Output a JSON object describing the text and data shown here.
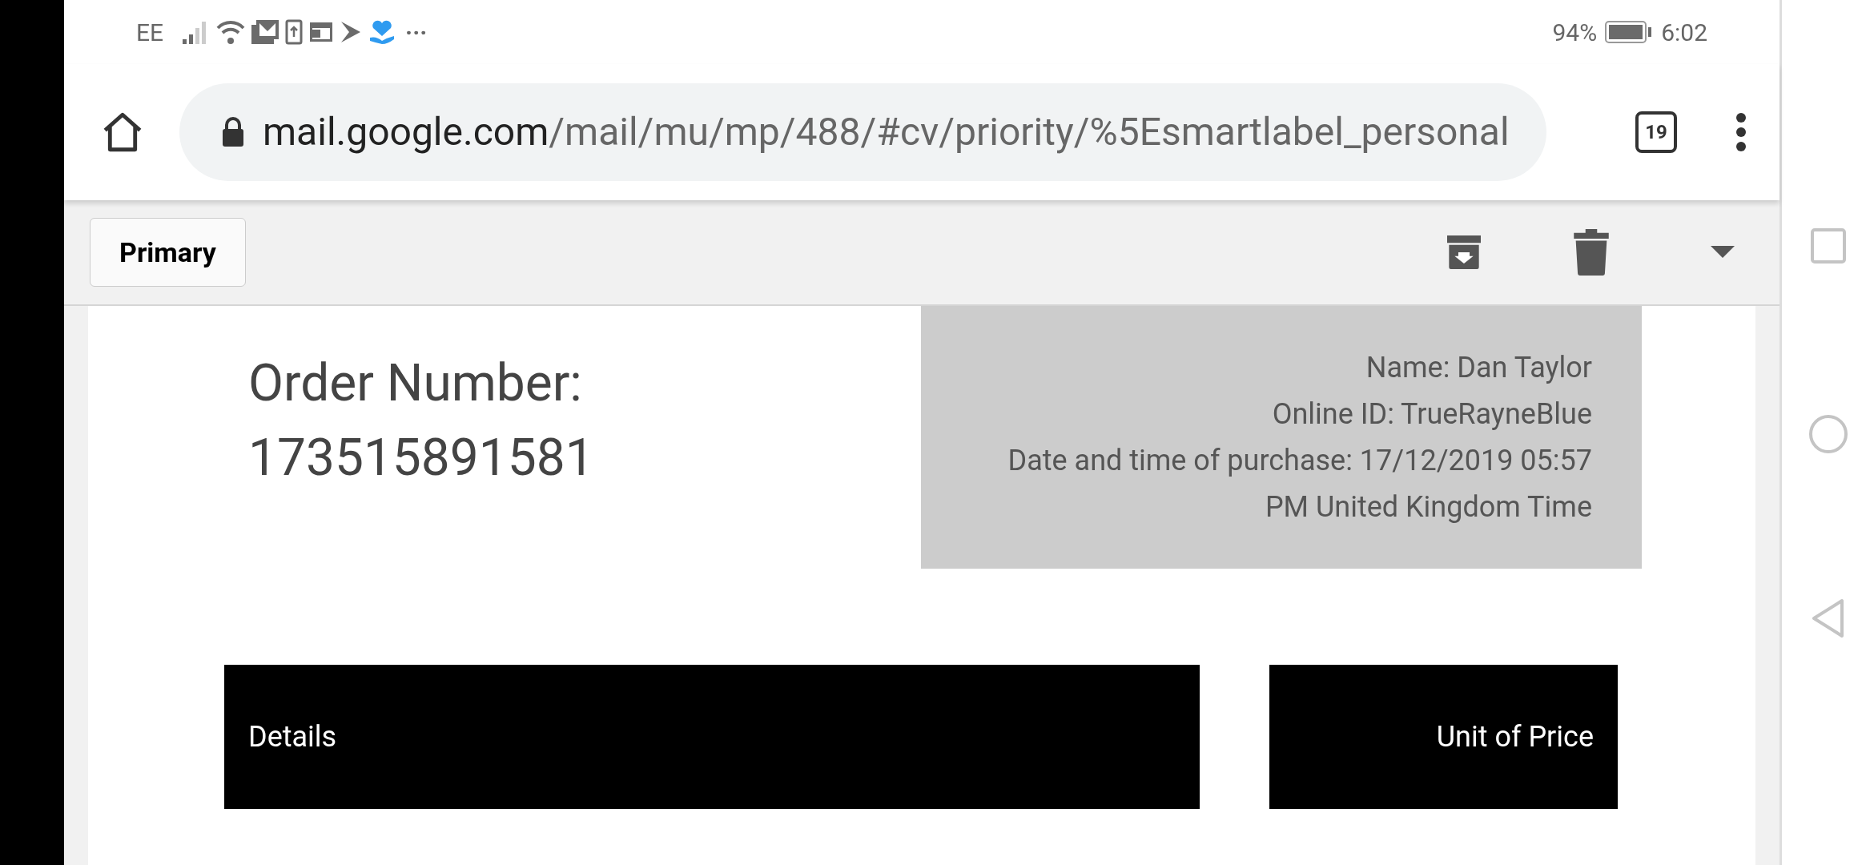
{
  "status_bar": {
    "carrier": "EE",
    "more": "···",
    "battery": "94%",
    "time": "6:02"
  },
  "address_bar": {
    "host": "mail.google.com",
    "path": "/mail/mu/mp/488/#cv/priority/%5Esmartlabel_personal",
    "tab_count": "19"
  },
  "toolbar": {
    "back_label": "Primary"
  },
  "order": {
    "label": "Order Number:",
    "number": "173515891581"
  },
  "purchase_info": [
    "Name: Dan Taylor",
    "Online ID: TrueRayneBlue",
    "Date and time of purchase: 17/12/2019 05:57",
    "PM United Kingdom Time"
  ],
  "table": {
    "columns": [
      "Details",
      "Unit of Price"
    ]
  }
}
